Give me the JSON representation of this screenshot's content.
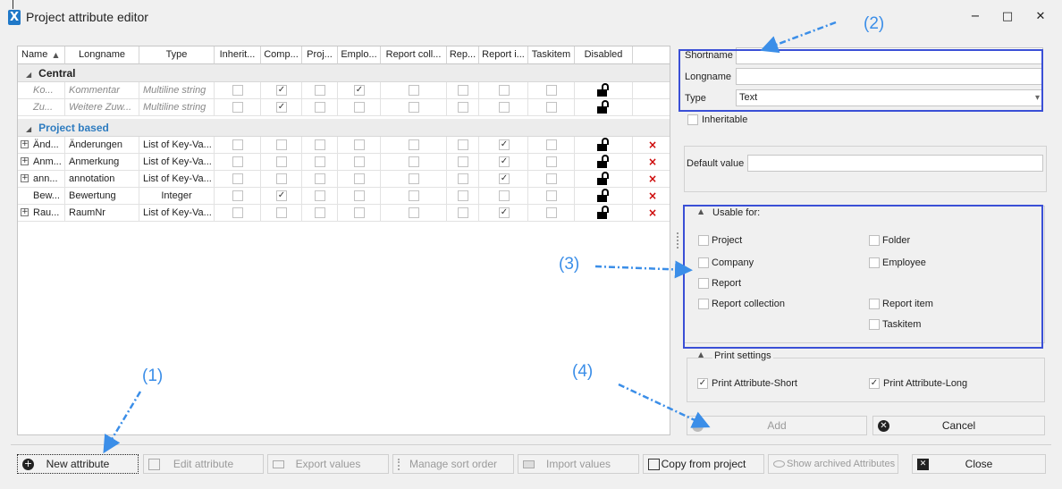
{
  "window": {
    "title": "Project attribute editor",
    "app_icon": "X",
    "minimize": "−",
    "maximize": "□",
    "close": "✕"
  },
  "grid": {
    "columns": [
      "Name",
      "Longname",
      "Type",
      "Inherit...",
      "Comp...",
      "Proj...",
      "Emplo...",
      "Report coll...",
      "Rep...",
      "Report i...",
      "Taskitem",
      "Disabled"
    ],
    "sort_indicator": "▲",
    "groups": [
      {
        "title": "Central"
      },
      {
        "title": "Project based"
      }
    ],
    "rows": [
      {
        "name": "Ko...",
        "longname": "Kommentar",
        "type": "Multiline string",
        "checks": [
          false,
          true,
          false,
          true,
          false,
          false,
          false,
          false
        ],
        "expand": false,
        "delete": false
      },
      {
        "name": "Zu...",
        "longname": "Weitere Zuw...",
        "type": "Multiline string",
        "checks": [
          false,
          true,
          false,
          false,
          false,
          false,
          false,
          false
        ],
        "expand": false,
        "delete": false
      },
      {
        "name": "Änd...",
        "longname": "Änderungen",
        "type": "List of Key-Va...",
        "checks": [
          false,
          false,
          false,
          false,
          false,
          false,
          true,
          false
        ],
        "expand": true,
        "delete": true
      },
      {
        "name": "Anm...",
        "longname": "Anmerkung",
        "type": "List of Key-Va...",
        "checks": [
          false,
          false,
          false,
          false,
          false,
          false,
          true,
          false
        ],
        "expand": true,
        "delete": true
      },
      {
        "name": "ann...",
        "longname": "annotation",
        "type": "List of Key-Va...",
        "checks": [
          false,
          false,
          false,
          false,
          false,
          false,
          true,
          false
        ],
        "expand": true,
        "delete": true
      },
      {
        "name": "Bew...",
        "longname": "Bewertung",
        "type": "Integer",
        "checks": [
          false,
          true,
          false,
          false,
          false,
          false,
          false,
          false
        ],
        "expand": false,
        "delete": true
      },
      {
        "name": "Rau...",
        "longname": "RaumNr",
        "type": "List of Key-Va...",
        "checks": [
          false,
          false,
          false,
          false,
          false,
          false,
          true,
          false
        ],
        "expand": true,
        "delete": true
      }
    ],
    "check_mark": "✓",
    "delete_mark": "×",
    "expand_mark": "+"
  },
  "editor": {
    "shortname_label": "Shortname",
    "shortname_value": "",
    "longname_label": "Longname",
    "longname_value": "",
    "type_label": "Type",
    "type_value": "Text",
    "type_arrow": "▾",
    "inheritable_label": "Inheritable",
    "default_label": "Default value",
    "default_value": "",
    "usable_title": "Usable for:",
    "usable": {
      "project": "Project",
      "folder": "Folder",
      "company": "Company",
      "employee": "Employee",
      "report": "Report",
      "report_collection": "Report collection",
      "report_item": "Report item",
      "taskitem": "Taskitem"
    },
    "print_title": "Print settings",
    "print_short": "Print Attribute-Short",
    "print_long": "Print Attribute-Long",
    "add_label": "Add",
    "cancel_label": "Cancel"
  },
  "toolbar": {
    "new_attribute": "New attribute",
    "edit_attribute": "Edit attribute",
    "export_values": "Export values",
    "manage_sort_order": "Manage sort order",
    "import_values": "Import values",
    "copy_from_project": "Copy from project",
    "show_archived": "Show archived Attributes",
    "close": "Close"
  },
  "annotations": {
    "a1": "(1)",
    "a2": "(2)",
    "a3": "(3)",
    "a4": "(4)"
  },
  "colors": {
    "accent": "#3b8ee8",
    "highlight_box": "#3a4fd6",
    "group_blue": "#2e7cc0",
    "delete_red": "#cc0000"
  }
}
